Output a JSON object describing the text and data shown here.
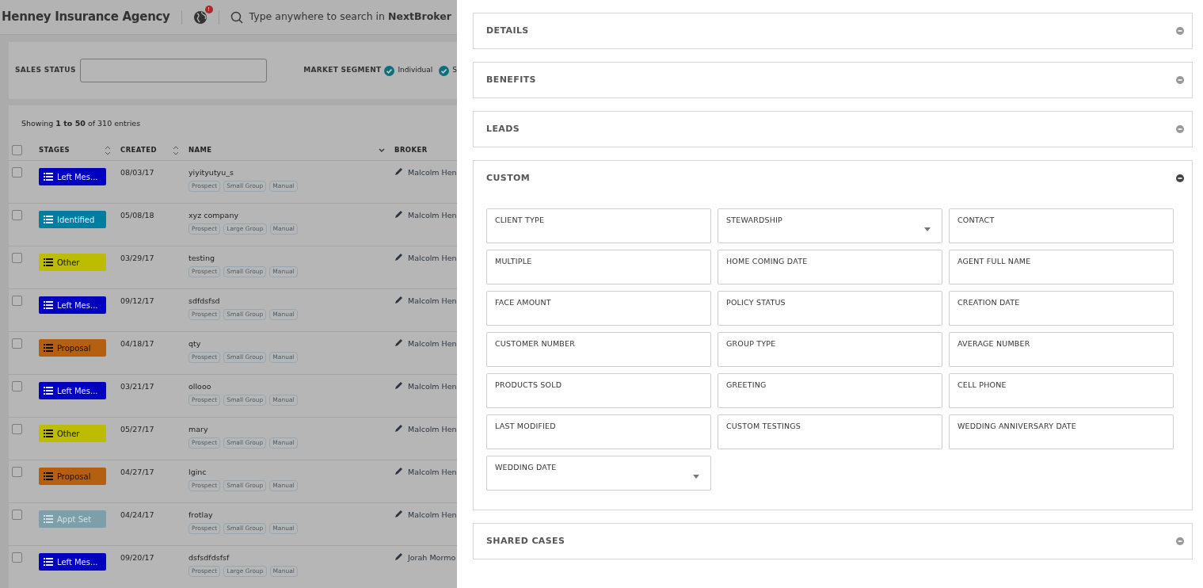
{
  "header": {
    "title": "Henney Insurance Agency",
    "notification_badge": "!",
    "search_text": "Type anywhere to search in **NextBroker**"
  },
  "filters": {
    "sales_status_label": "SALES STATUS",
    "market_segment_label": "MARKET SEGMENT",
    "segments": [
      {
        "label": "Individual",
        "checked": true
      },
      {
        "label": "S",
        "checked": true
      }
    ]
  },
  "table": {
    "summary": "Showing **1 to 50** of 310 entries",
    "all_selected": false,
    "columns": [
      {
        "label": "STAGES",
        "sortable": true,
        "sorted": false
      },
      {
        "label": "CREATED",
        "sortable": true,
        "sorted": false
      },
      {
        "label": "NAME",
        "sortable": true,
        "sorted": true
      },
      {
        "label": "BROKER",
        "sortable": false
      }
    ],
    "rows": [
      {
        "checked": false,
        "stage": "Left Mes...",
        "color": "#0000c0",
        "dark_text": false,
        "faded": false,
        "created": "08/03/17",
        "name": "yiyityutyu_s",
        "tags": [
          "Prospect",
          "Small Group",
          "Manual"
        ],
        "broker": "Malcolm Hen"
      },
      {
        "checked": false,
        "stage": "Identified",
        "color": "#007ea0",
        "dark_text": false,
        "faded": false,
        "created": "05/08/18",
        "name": "xyz company",
        "tags": [
          "Prospect",
          "Large Group",
          "Manual"
        ],
        "broker": "Malcolm Hen"
      },
      {
        "checked": false,
        "stage": "Other",
        "color": "#bcbc00",
        "dark_text": true,
        "faded": false,
        "created": "03/29/17",
        "name": "testing",
        "tags": [
          "Prospect",
          "Small Group",
          "Manual"
        ],
        "broker": "Malcolm Hen"
      },
      {
        "checked": false,
        "stage": "Left Mes...",
        "color": "#0000c0",
        "dark_text": false,
        "faded": false,
        "created": "09/12/17",
        "name": "sdfdsfsd",
        "tags": [
          "Prospect",
          "Small Group",
          "Manual"
        ],
        "broker": "Malcolm Hen"
      },
      {
        "checked": false,
        "stage": "Proposal",
        "color": "#b55f10",
        "dark_text": true,
        "faded": false,
        "created": "04/18/17",
        "name": "qty",
        "tags": [
          "Prospect",
          "Small Group",
          "Manual"
        ],
        "broker": "Malcolm Hen"
      },
      {
        "checked": false,
        "stage": "Left Mes...",
        "color": "#0000c0",
        "dark_text": false,
        "faded": false,
        "created": "03/21/17",
        "name": "ollooo",
        "tags": [
          "Prospect",
          "Small Group",
          "Manual"
        ],
        "broker": "Malcolm Hen"
      },
      {
        "checked": false,
        "stage": "Other",
        "color": "#bcbc00",
        "dark_text": true,
        "faded": false,
        "created": "05/27/17",
        "name": "mary",
        "tags": [
          "Prospect",
          "Small Group",
          "Manual"
        ],
        "broker": "Malcolm Hen"
      },
      {
        "checked": false,
        "stage": "Proposal",
        "color": "#b55f10",
        "dark_text": true,
        "faded": false,
        "created": "04/27/17",
        "name": "lginc",
        "tags": [
          "Prospect",
          "Small Group",
          "Manual"
        ],
        "broker": "Malcolm Hen"
      },
      {
        "checked": false,
        "stage": "Appt Set",
        "color": "#7d9fa9",
        "dark_text": false,
        "faded": true,
        "created": "04/24/17",
        "name": "frotlay",
        "tags": [
          "Prospect",
          "Small Group",
          "Manual"
        ],
        "broker": "Malcolm Hen"
      },
      {
        "checked": false,
        "stage": "Left Mes...",
        "color": "#0000c0",
        "dark_text": false,
        "faded": false,
        "created": "09/20/17",
        "name": "dsfsdfdsfsf",
        "tags": [
          "Prospect",
          "Large Group",
          "Manual"
        ],
        "broker": "Jorah Mormo"
      }
    ]
  },
  "panel": {
    "sections": [
      {
        "title": "DETAILS",
        "expanded": false
      },
      {
        "title": "BENEFITS",
        "expanded": false
      },
      {
        "title": "LEADS",
        "expanded": false
      },
      {
        "title": "CUSTOM",
        "expanded": true,
        "fields": [
          {
            "label": "CLIENT TYPE",
            "kind": "text"
          },
          {
            "label": "STEWARDSHIP",
            "kind": "select"
          },
          {
            "label": "CONTACT",
            "kind": "text"
          },
          {
            "label": "MULTIPLE",
            "kind": "text"
          },
          {
            "label": "HOME COMING DATE",
            "kind": "text"
          },
          {
            "label": "AGENT FULL NAME",
            "kind": "text"
          },
          {
            "label": "FACE AMOUNT",
            "kind": "text"
          },
          {
            "label": "POLICY STATUS",
            "kind": "text"
          },
          {
            "label": "CREATION DATE",
            "kind": "text"
          },
          {
            "label": "CUSTOMER NUMBER",
            "kind": "text"
          },
          {
            "label": "GROUP TYPE",
            "kind": "text"
          },
          {
            "label": "AVERAGE NUMBER",
            "kind": "text"
          },
          {
            "label": "PRODUCTS SOLD",
            "kind": "text"
          },
          {
            "label": "GREETING",
            "kind": "text"
          },
          {
            "label": "CELL PHONE",
            "kind": "text"
          },
          {
            "label": "LAST MODIFIED",
            "kind": "text"
          },
          {
            "label": "CUSTOM TESTINGS",
            "kind": "text"
          },
          {
            "label": "WEDDING ANNIVERSARY DATE",
            "kind": "text"
          },
          {
            "label": "WEDDING DATE",
            "kind": "select"
          }
        ]
      },
      {
        "title": "SHARED CASES",
        "expanded": false
      }
    ]
  }
}
